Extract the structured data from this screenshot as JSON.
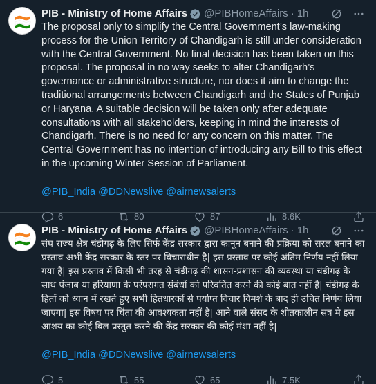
{
  "tweets": [
    {
      "author_name": "PIB - Ministry of Home Affairs",
      "handle": "@PIBHomeAffairs",
      "separator": "·",
      "time": "1h",
      "text": "The proposal only to simplify the Central Government’s law-making process for the Union Territory of Chandigarh is still under consideration with the Central Government. No final decision has been taken on this proposal. The proposal in no way seeks to alter Chandigarh’s governance or administrative structure, nor does it aim to change the traditional arrangements between Chandigarh and the States of Punjab or Haryana. A suitable decision will be taken only after adequate consultations with all stakeholders, keeping in mind the interests of Chandigarh. There is no need for any concern on this matter. The Central Government has no intention of introducing any Bill to this effect in the upcoming Winter Session of Parliament.",
      "mentions": [
        "@PIB_India",
        "@DDNewslive",
        "@airnewsalerts"
      ],
      "replies": "6",
      "reposts": "80",
      "likes": "87",
      "views": "8.6K"
    },
    {
      "author_name": "PIB - Ministry of Home Affairs",
      "handle": "@PIBHomeAffairs",
      "separator": "·",
      "time": "1h",
      "text": "संघ राज्य क्षेत्र चंडीगढ़ के लिए सिर्फ केंद्र सरकार द्वारा कानून बनाने की प्रक्रिया को सरल बनाने का प्रस्ताव अभी केंद्र सरकार के स्तर पर विचाराधीन है| इस प्रस्ताव पर कोई अंतिम निर्णय नहीं लिया गया है| इस प्रस्ताव में किसी भी तरह से चंडीगढ़ की शासन-प्रशासन की व्यवस्था या चंडीगढ़ के साथ पंजाब या हरियाणा के परंपरागत संबंधों को परिवर्तित करने की कोई बात नहीं है| चंडीगढ़ के हितों को ध्यान में रखते हुए सभी हितधारकों से पर्याप्त विचार विमर्श के बाद ही उचित निर्णय लिया जाएगा| इस विषय पर चिंता की आवश्यकता नहीं है| आने वाले संसद के शीतकालीन सत्र मे इस आशय का कोई बिल प्रस्तुत करने की केंद्र सरकार की कोई मंशा नहीं है|",
      "mentions": [
        "@PIB_India",
        "@DDNewslive",
        "@airnewsalerts"
      ],
      "replies": "5",
      "reposts": "55",
      "likes": "65",
      "views": "7.5K"
    }
  ],
  "icons": {
    "verified": "verified-badge-icon",
    "grok": "grok-icon",
    "more": "more-icon",
    "reply": "reply-icon",
    "repost": "repost-icon",
    "like": "like-icon",
    "views": "views-icon",
    "share": "share-icon"
  },
  "colors": {
    "background": "#15202b",
    "text": "#e7e9ea",
    "muted": "#8b98a5",
    "link": "#1d9bf0",
    "divider": "#38444d"
  }
}
